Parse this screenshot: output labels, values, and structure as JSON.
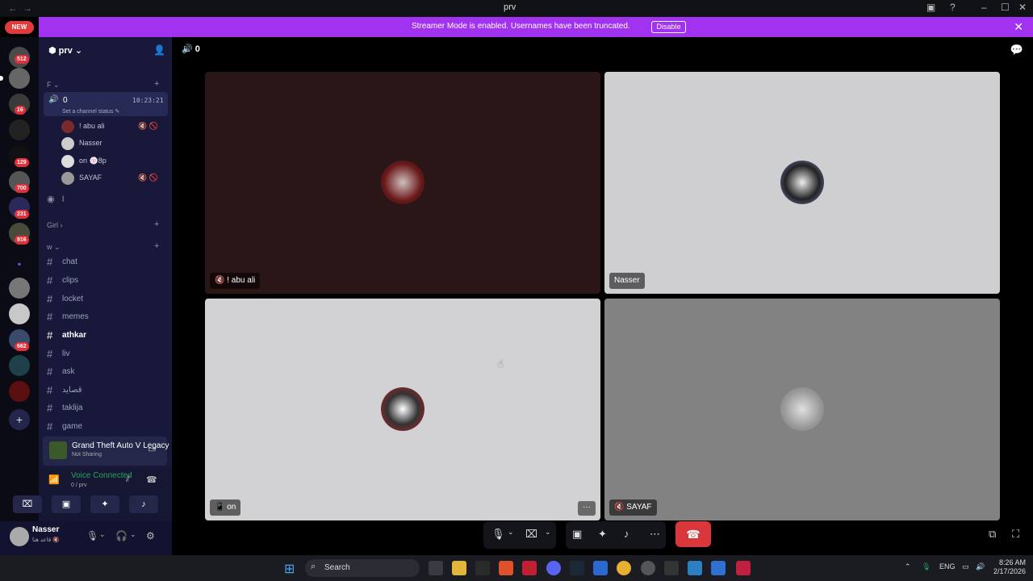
{
  "titlebar": {
    "back": "←",
    "forward": "→",
    "title": "prv"
  },
  "banner": {
    "message": "Streamer Mode is enabled. Usernames have been truncated.",
    "button": "Disable",
    "close": "✕"
  },
  "new_pill": "NEW",
  "server_badges": [
    "512",
    "16",
    "129",
    "700",
    "231",
    "916",
    "662"
  ],
  "sidebar": {
    "server_name": "prv",
    "category_f": "F",
    "voice_channel": {
      "name": "0",
      "time": "10:23:21",
      "status": "Set a channel status"
    },
    "voice_users": [
      {
        "name": "! abu ali",
        "icons": "🔇 🚫"
      },
      {
        "name": "Nasser",
        "icons": ""
      },
      {
        "name": "on",
        "extra": "🍥8p",
        "icons": ""
      },
      {
        "name": "SAYAF",
        "icons": "🔇 🚫"
      }
    ],
    "stage_channel": "l",
    "category_girl": "Girl",
    "category_w": "w",
    "text_channels": [
      "chat",
      "clips",
      "locket",
      "memes",
      "athkar",
      "liv",
      "ask",
      "قصايد",
      "taklija",
      "game"
    ]
  },
  "activity": {
    "game": "Grand Theft Auto V Legacy",
    "status": "Not Sharing"
  },
  "voice_connected": {
    "title": "Voice Connected",
    "subtitle": "0 / prv"
  },
  "user": {
    "name": "Nasser",
    "status": "قاعد هنا 🔇"
  },
  "main": {
    "channel_title": "0",
    "tiles": [
      {
        "label": "! abu ali",
        "label_icon": "🔇",
        "bg": "#2a1616"
      },
      {
        "label": "Nasser",
        "label_icon": "",
        "bg": "#cfcfd2"
      },
      {
        "label": "on",
        "label_icon": "📱",
        "bg": "#d2d2d4"
      },
      {
        "label": "SAYAF",
        "label_icon": "🔇",
        "bg": "#828282"
      }
    ],
    "more": "···"
  },
  "taskbar": {
    "search": "Search",
    "lang": "ENG",
    "time": "8:26 AM",
    "date": "2/17/2026"
  },
  "colors": {
    "banner": "#a032f0",
    "voice_green": "#23a55a",
    "end_call": "#da373c"
  }
}
